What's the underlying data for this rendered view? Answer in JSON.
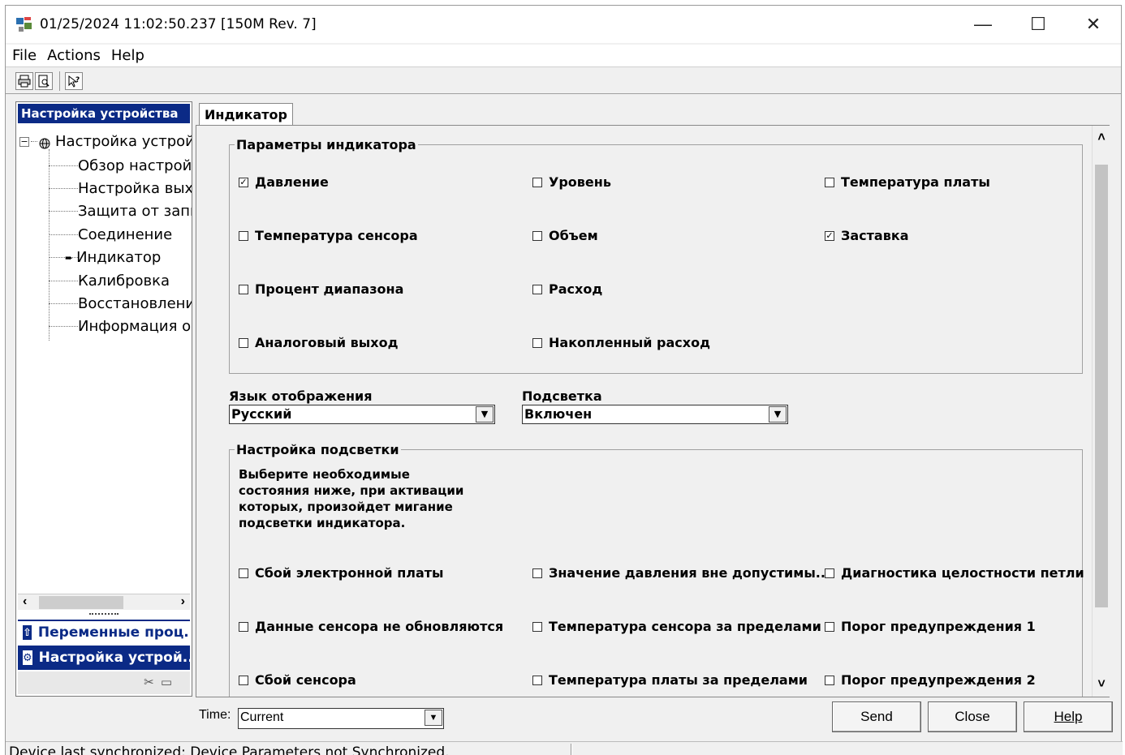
{
  "window": {
    "title": "01/25/2024 11:02:50.237 [150M Rev. 7]",
    "controls": {
      "minimize": "—",
      "maximize": "☐",
      "close": "✕"
    }
  },
  "menu": {
    "items": [
      "File",
      "Actions",
      "Help"
    ]
  },
  "toolbar": {
    "icons": [
      "print-icon",
      "print-preview-icon",
      "context-help-icon"
    ]
  },
  "left_panel": {
    "header": "Настройка устройства",
    "tree": {
      "root": "Настройка устройства",
      "items": [
        {
          "label": "Обзор настройки",
          "active": false
        },
        {
          "label": "Настройка выхода",
          "active": false
        },
        {
          "label": "Защита от записи",
          "active": false
        },
        {
          "label": "Соединение",
          "active": false
        },
        {
          "label": "Индикатор",
          "active": true
        },
        {
          "label": "Калибровка",
          "active": false
        },
        {
          "label": "Восстановление/",
          "active": false
        },
        {
          "label": "Информация об",
          "active": false
        }
      ]
    },
    "nav": {
      "vars": "Переменные проц...",
      "settings": "Настройка устрой..."
    }
  },
  "tab": {
    "label": "Индикатор"
  },
  "display_params": {
    "legend": "Параметры индикатора",
    "checkboxes": [
      {
        "label": "Давление",
        "checked": true
      },
      {
        "label": "Уровень",
        "checked": false
      },
      {
        "label": "Температура платы",
        "checked": false
      },
      {
        "label": "Температура сенсора",
        "checked": false
      },
      {
        "label": "Объем",
        "checked": false
      },
      {
        "label": "Заставка",
        "checked": true
      },
      {
        "label": "Процент диапазона",
        "checked": false
      },
      {
        "label": "Расход",
        "checked": false
      },
      {
        "label": "Аналоговый выход",
        "checked": false
      },
      {
        "label": "Накопленный расход",
        "checked": false
      }
    ]
  },
  "language": {
    "label": "Язык отображения",
    "value": "Русский"
  },
  "backlight": {
    "label": "Подсветка",
    "value": "Включен"
  },
  "backlight_settings": {
    "legend": "Настройка подсветки",
    "description": "Выберите необходимые состояния ниже, при активации которых, произойдет мигание подсветки индикатора.",
    "checkboxes": [
      {
        "label": "Сбой электронной платы",
        "checked": false
      },
      {
        "label": "Значение давления вне допустимы...",
        "checked": false
      },
      {
        "label": "Диагностика целостности петли",
        "checked": false
      },
      {
        "label": "Данные сенсора не обновляются",
        "checked": false
      },
      {
        "label": "Температура сенсора за пределами",
        "checked": false
      },
      {
        "label": "Порог предупреждения 1",
        "checked": false
      },
      {
        "label": "Сбой сенсора",
        "checked": false
      },
      {
        "label": "Температура платы за пределами",
        "checked": false
      },
      {
        "label": "Порог предупреждения 2",
        "checked": false
      }
    ]
  },
  "bottom": {
    "time_label": "Time:",
    "time_value": "Current",
    "send": "Send",
    "close": "Close",
    "help": "Help"
  },
  "status": {
    "text": "Device last synchronized: Device Parameters not Synchronized."
  },
  "colors": {
    "nav_blue": "#0b2a86"
  }
}
